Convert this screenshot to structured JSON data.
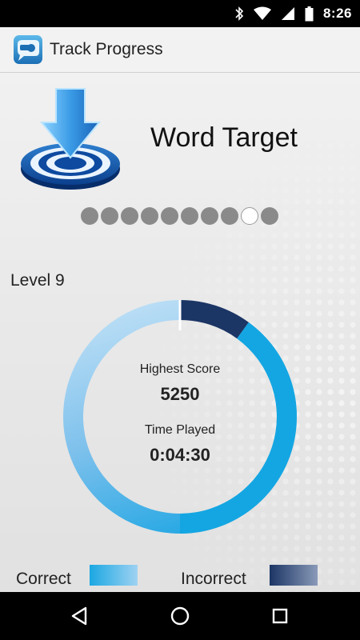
{
  "status_bar": {
    "time": "8:26",
    "icons": [
      "bluetooth-icon",
      "wifi-icon",
      "signal-icon",
      "battery-icon"
    ]
  },
  "app_bar": {
    "title": "Track Progress",
    "icon": "whistle-chat-icon"
  },
  "game": {
    "title": "Word Target",
    "icon": "download-target-icon",
    "level_dots": {
      "total": 10,
      "active_index": 8
    },
    "level_label": "Level 9"
  },
  "progress_ring": {
    "correct_fraction": 0.9,
    "incorrect_fraction": 0.1,
    "highest_score_label": "Highest Score",
    "highest_score_value": "5250",
    "time_played_label": "Time Played",
    "time_played_value": "0:04:30"
  },
  "legend": {
    "correct_label": "Correct",
    "incorrect_label": "Incorrect"
  },
  "colors": {
    "correct_light": "#a8d4f0",
    "correct_dark": "#0fa0de",
    "incorrect": "#1b3565",
    "inactive_dot": "#8a8a8a"
  },
  "nav_bar": {
    "icons": [
      "back-icon",
      "home-icon",
      "recents-icon"
    ]
  }
}
